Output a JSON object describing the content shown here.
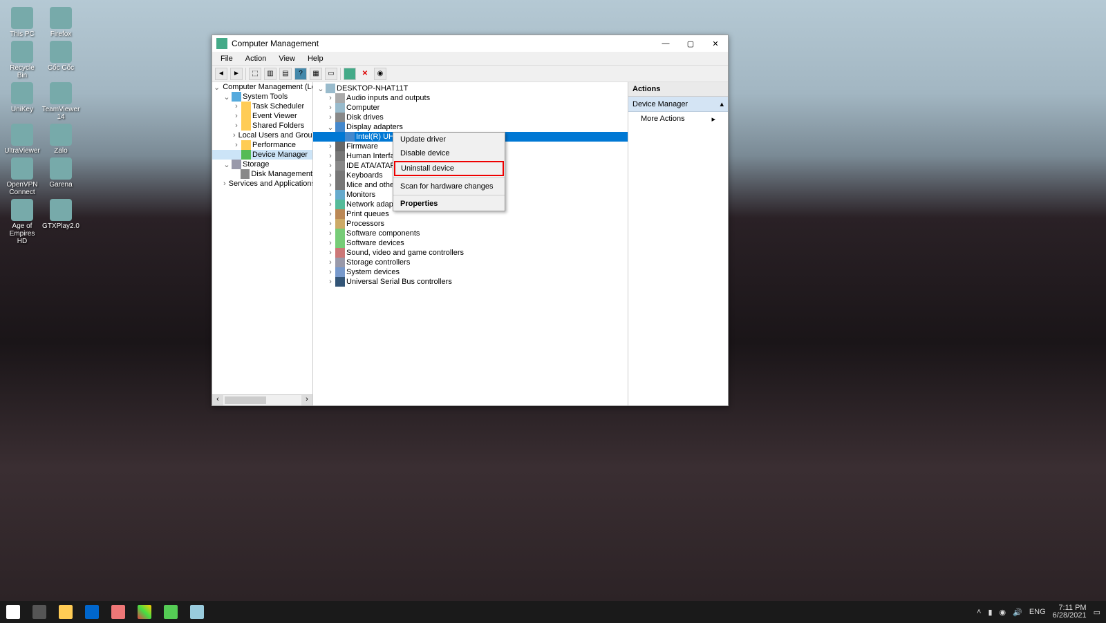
{
  "desktop": {
    "icons_col1": [
      "This PC",
      "Recycle Bin",
      "UniKey",
      "UltraViewer",
      "OpenVPN Connect",
      "Age of Empires HD"
    ],
    "icons_col2": [
      "Firefox",
      "Cốc Cốc",
      "TeamViewer 14",
      "Zalo",
      "Garena",
      "GTXPlay2.0"
    ]
  },
  "window": {
    "title": "Computer Management",
    "menu": [
      "File",
      "Action",
      "View",
      "Help"
    ],
    "left_tree": [
      {
        "d": 0,
        "exp": "v",
        "icon": "mgr",
        "label": "Computer Management (Local"
      },
      {
        "d": 1,
        "exp": "v",
        "icon": "tool",
        "label": "System Tools"
      },
      {
        "d": 2,
        "exp": ">",
        "icon": "fld",
        "label": "Task Scheduler"
      },
      {
        "d": 2,
        "exp": ">",
        "icon": "fld",
        "label": "Event Viewer"
      },
      {
        "d": 2,
        "exp": ">",
        "icon": "fld",
        "label": "Shared Folders"
      },
      {
        "d": 2,
        "exp": ">",
        "icon": "fld",
        "label": "Local Users and Groups"
      },
      {
        "d": 2,
        "exp": ">",
        "icon": "fld",
        "label": "Performance"
      },
      {
        "d": 2,
        "exp": "",
        "icon": "mgr",
        "label": "Device Manager",
        "sel": true
      },
      {
        "d": 1,
        "exp": "v",
        "icon": "stor",
        "label": "Storage"
      },
      {
        "d": 2,
        "exp": "",
        "icon": "disk",
        "label": "Disk Management"
      },
      {
        "d": 1,
        "exp": ">",
        "icon": "tool",
        "label": "Services and Applications"
      }
    ],
    "device_tree": [
      {
        "d": 0,
        "exp": "v",
        "icon": "pc",
        "label": "DESKTOP-NHAT11T"
      },
      {
        "d": 1,
        "exp": ">",
        "icon": "aud",
        "label": "Audio inputs and outputs"
      },
      {
        "d": 1,
        "exp": ">",
        "icon": "pc",
        "label": "Computer"
      },
      {
        "d": 1,
        "exp": ">",
        "icon": "disk",
        "label": "Disk drives"
      },
      {
        "d": 1,
        "exp": "v",
        "icon": "disp",
        "label": "Display adapters"
      },
      {
        "d": 2,
        "exp": "",
        "icon": "disp",
        "label": "Intel(R) UHD Graphics 620",
        "hl": true
      },
      {
        "d": 1,
        "exp": ">",
        "icon": "fw",
        "label": "Firmware"
      },
      {
        "d": 1,
        "exp": ">",
        "icon": "kb",
        "label": "Human Interface Devices"
      },
      {
        "d": 1,
        "exp": ">",
        "icon": "disk",
        "label": "IDE ATA/ATAPI controllers"
      },
      {
        "d": 1,
        "exp": ">",
        "icon": "kb",
        "label": "Keyboards"
      },
      {
        "d": 1,
        "exp": ">",
        "icon": "kb",
        "label": "Mice and other pointing devices"
      },
      {
        "d": 1,
        "exp": ">",
        "icon": "mon",
        "label": "Monitors"
      },
      {
        "d": 1,
        "exp": ">",
        "icon": "net",
        "label": "Network adapters"
      },
      {
        "d": 1,
        "exp": ">",
        "icon": "prn",
        "label": "Print queues"
      },
      {
        "d": 1,
        "exp": ">",
        "icon": "cpu",
        "label": "Processors"
      },
      {
        "d": 1,
        "exp": ">",
        "icon": "sw",
        "label": "Software components"
      },
      {
        "d": 1,
        "exp": ">",
        "icon": "sw",
        "label": "Software devices"
      },
      {
        "d": 1,
        "exp": ">",
        "icon": "snd",
        "label": "Sound, video and game controllers"
      },
      {
        "d": 1,
        "exp": ">",
        "icon": "stor",
        "label": "Storage controllers"
      },
      {
        "d": 1,
        "exp": ">",
        "icon": "sys",
        "label": "System devices"
      },
      {
        "d": 1,
        "exp": ">",
        "icon": "usb",
        "label": "Universal Serial Bus controllers"
      }
    ],
    "actions": {
      "header": "Actions",
      "sub": "Device Manager",
      "item": "More Actions"
    },
    "context_menu": {
      "items": [
        "Update driver",
        "Disable device",
        "Uninstall device",
        "Scan for hardware changes"
      ],
      "highlighted_index": 2,
      "properties": "Properties"
    }
  },
  "taskbar": {
    "tray": {
      "lang": "ENG",
      "time": "7:11 PM",
      "date": "6/28/2021"
    }
  }
}
